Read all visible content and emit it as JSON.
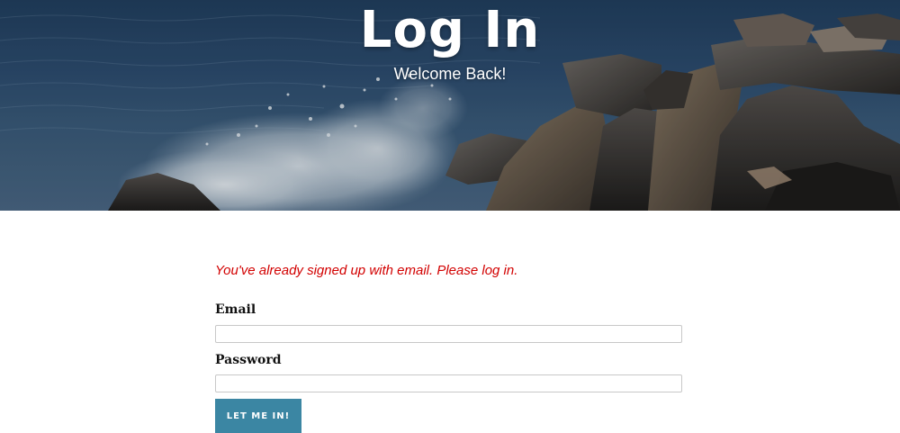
{
  "hero": {
    "title": "Log In",
    "subtitle": "Welcome Back!",
    "image": "ocean-waves-on-rocks"
  },
  "form": {
    "alert": "You've already signed up with email. Please log in.",
    "email_label": "Email",
    "email_value": "",
    "password_label": "Password",
    "password_value": "",
    "submit_label": "LET ME IN!"
  },
  "colors": {
    "alert": "#d20000",
    "button": "#3b86a3",
    "button_text": "#ffffff"
  }
}
